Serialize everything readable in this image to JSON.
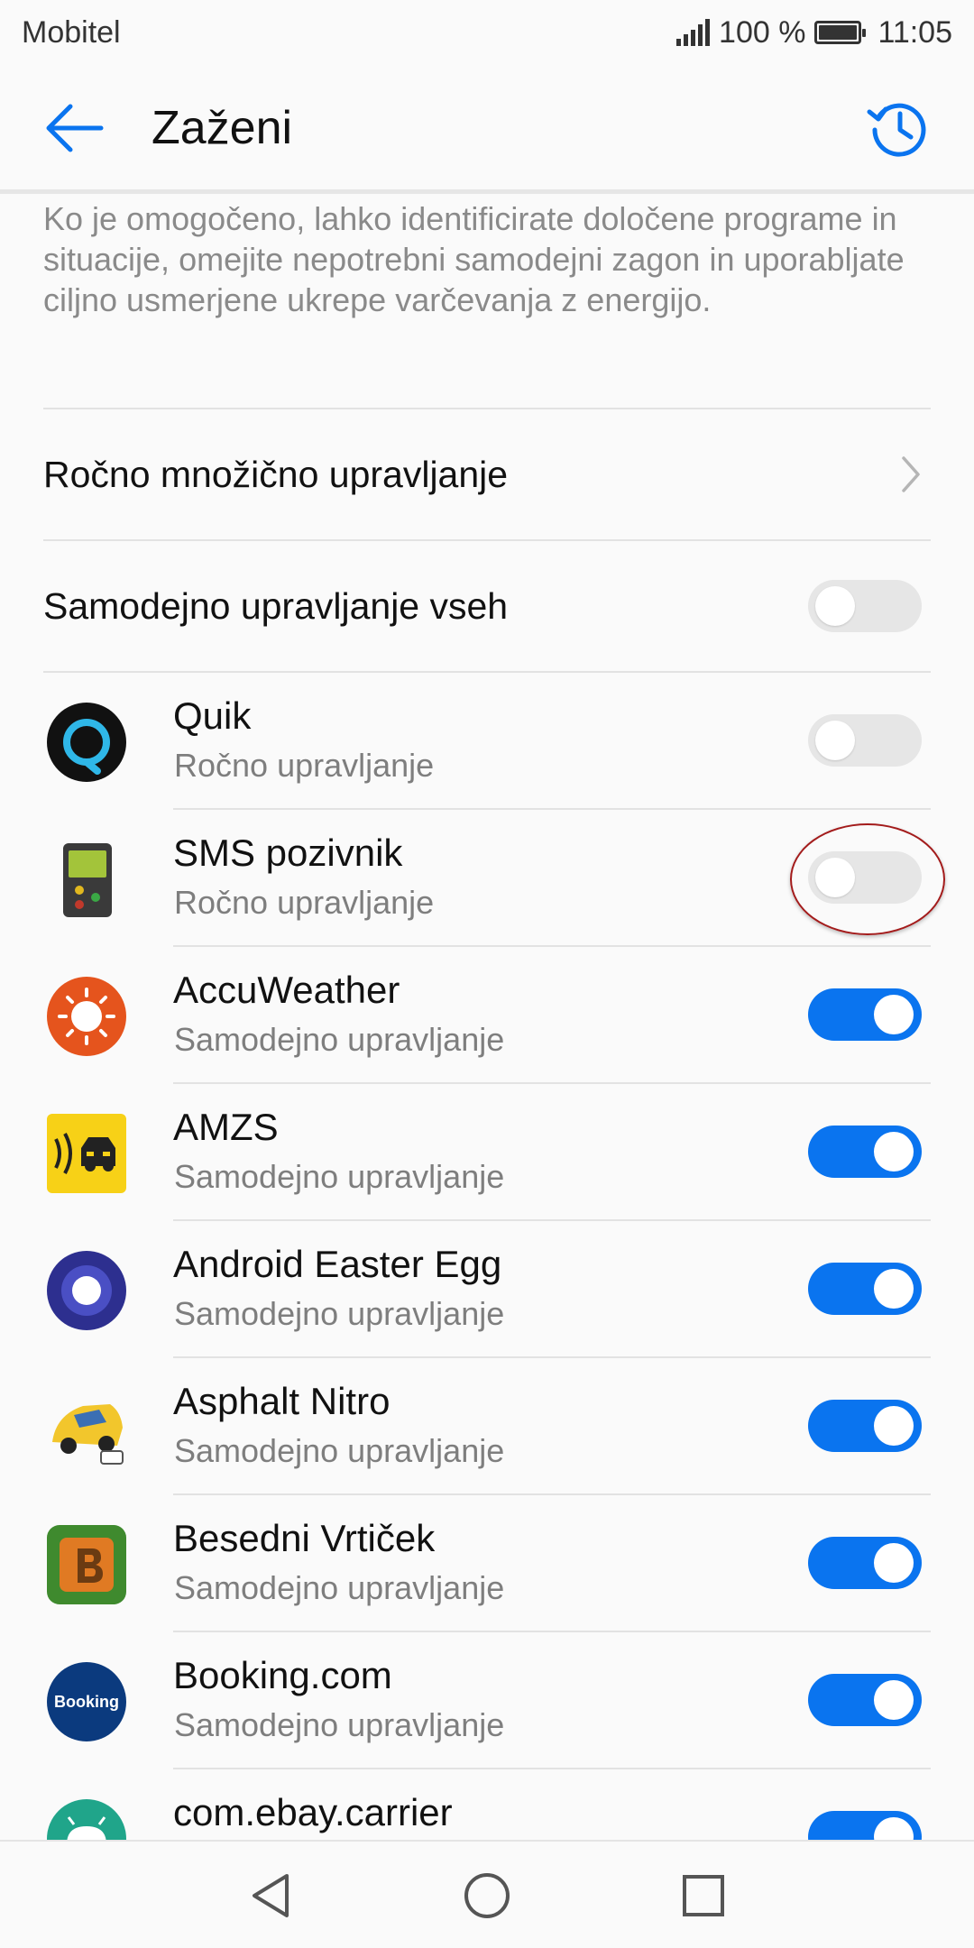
{
  "status_bar": {
    "carrier": "Mobitel",
    "battery_percent": "100 %",
    "time": "11:05"
  },
  "toolbar": {
    "title": "Zaženi",
    "back_icon": "arrow-left-icon",
    "history_icon": "history-clock-icon"
  },
  "description": "Ko je omogočeno, lahko identificirate določene programe in situacije, omejite nepotrebni samodejni zagon in uporabljate ciljno usmerjene ukrepe varčevanja z energijo.",
  "manual_batch": {
    "label": "Ročno množično upravljanje"
  },
  "auto_all": {
    "label": "Samodejno upravljanje vseh",
    "enabled": false
  },
  "apps": [
    {
      "name": "Quik",
      "mode": "Ročno upravljanje",
      "enabled": false,
      "icon": "quik-icon"
    },
    {
      "name": "SMS pozivnik",
      "mode": "Ročno upravljanje",
      "enabled": false,
      "icon": "pager-icon"
    },
    {
      "name": "AccuWeather",
      "mode": "Samodejno upravljanje",
      "enabled": true,
      "icon": "accuweather-sun-icon"
    },
    {
      "name": "AMZS",
      "mode": "Samodejno upravljanje",
      "enabled": true,
      "icon": "amzs-car-icon"
    },
    {
      "name": "Android Easter Egg",
      "mode": "Samodejno upravljanje",
      "enabled": true,
      "icon": "easter-egg-ring-icon"
    },
    {
      "name": "Asphalt Nitro",
      "mode": "Samodejno upravljanje",
      "enabled": true,
      "icon": "asphalt-car-icon"
    },
    {
      "name": "Besedni Vrtiček",
      "mode": "Samodejno upravljanje",
      "enabled": true,
      "icon": "letter-b-tile-icon"
    },
    {
      "name": "Booking.com",
      "mode": "Samodejno upravljanje",
      "enabled": true,
      "icon": "booking-icon",
      "icon_text": "Booking"
    },
    {
      "name": "com.ebay.carrier",
      "mode": "",
      "enabled": true,
      "icon": "android-robot-icon"
    }
  ],
  "nav_bar": {
    "back_icon": "nav-back-triangle-icon",
    "home_icon": "nav-home-circle-icon",
    "recents_icon": "nav-recents-square-icon"
  },
  "colors": {
    "accent": "#0a74ef",
    "toggle_off": "#e6e6e6",
    "highlight_ring": "#a31b1b"
  }
}
